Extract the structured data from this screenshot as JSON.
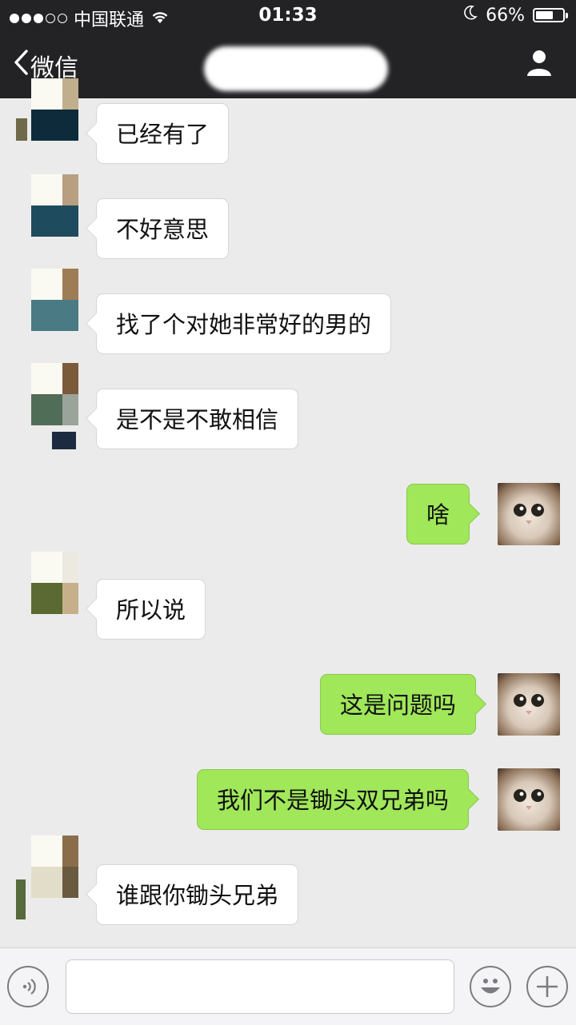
{
  "status_bar": {
    "carrier": "中国联通",
    "signal_bars": 5,
    "signal_filled": 3,
    "time": "01:33",
    "battery_text": "66%",
    "battery_level": 0.66
  },
  "nav": {
    "back_label": "微信",
    "title": ""
  },
  "messages": [
    {
      "side": "in",
      "text": "已经有了"
    },
    {
      "side": "in",
      "text": "不好意思"
    },
    {
      "side": "in",
      "text": "找了个对她非常好的男的"
    },
    {
      "side": "in",
      "text": "是不是不敢相信"
    },
    {
      "side": "out",
      "text": "啥"
    },
    {
      "side": "in",
      "text": "所以说"
    },
    {
      "side": "out",
      "text": "这是问题吗"
    },
    {
      "side": "out",
      "text": "我们不是锄头双兄弟吗"
    },
    {
      "side": "in",
      "text": "谁跟你锄头兄弟"
    }
  ],
  "input": {
    "value": "",
    "placeholder": ""
  },
  "icons": {
    "back": "chevron-left-icon",
    "profile": "person-icon",
    "voice": "voice-icon",
    "emoji": "emoji-icon",
    "plus": "plus-icon",
    "moon": "moon-icon",
    "wifi": "wifi-icon"
  },
  "colors": {
    "outgoing_bubble": "#a0e75a",
    "incoming_bubble": "#ffffff",
    "background": "#ebebeb",
    "header": "#232326"
  }
}
